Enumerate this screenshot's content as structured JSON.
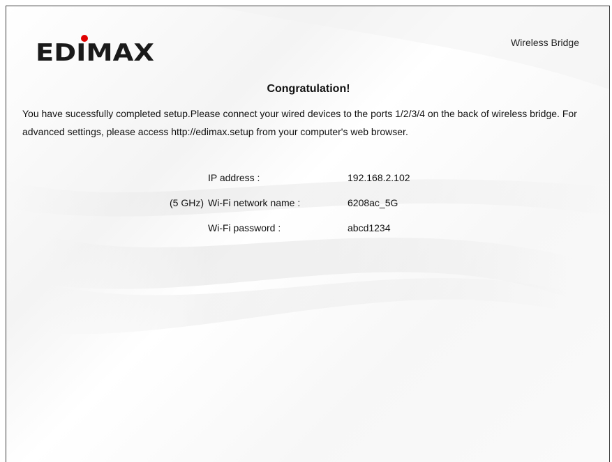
{
  "header": {
    "brand": "EDIMAX",
    "product_name": "Wireless Bridge"
  },
  "main": {
    "title": "Congratulation!",
    "message": "You have sucessfully completed setup.Please connect your wired devices to the ports 1/2/3/4 on the back of wireless bridge. For advanced settings, please access http://edimax.setup from your computer's web browser.",
    "info": [
      {
        "prefix": "",
        "label": "IP address :",
        "value": "192.168.2.102"
      },
      {
        "prefix": "(5 GHz)",
        "label": "Wi-Fi network name :",
        "value": "6208ac_5G"
      },
      {
        "prefix": "",
        "label": "Wi-Fi password :",
        "value": "abcd1234"
      }
    ]
  },
  "colors": {
    "logo": "#1a1a1a",
    "logo_dot": "#e00000",
    "border": "#3a3a3a"
  }
}
